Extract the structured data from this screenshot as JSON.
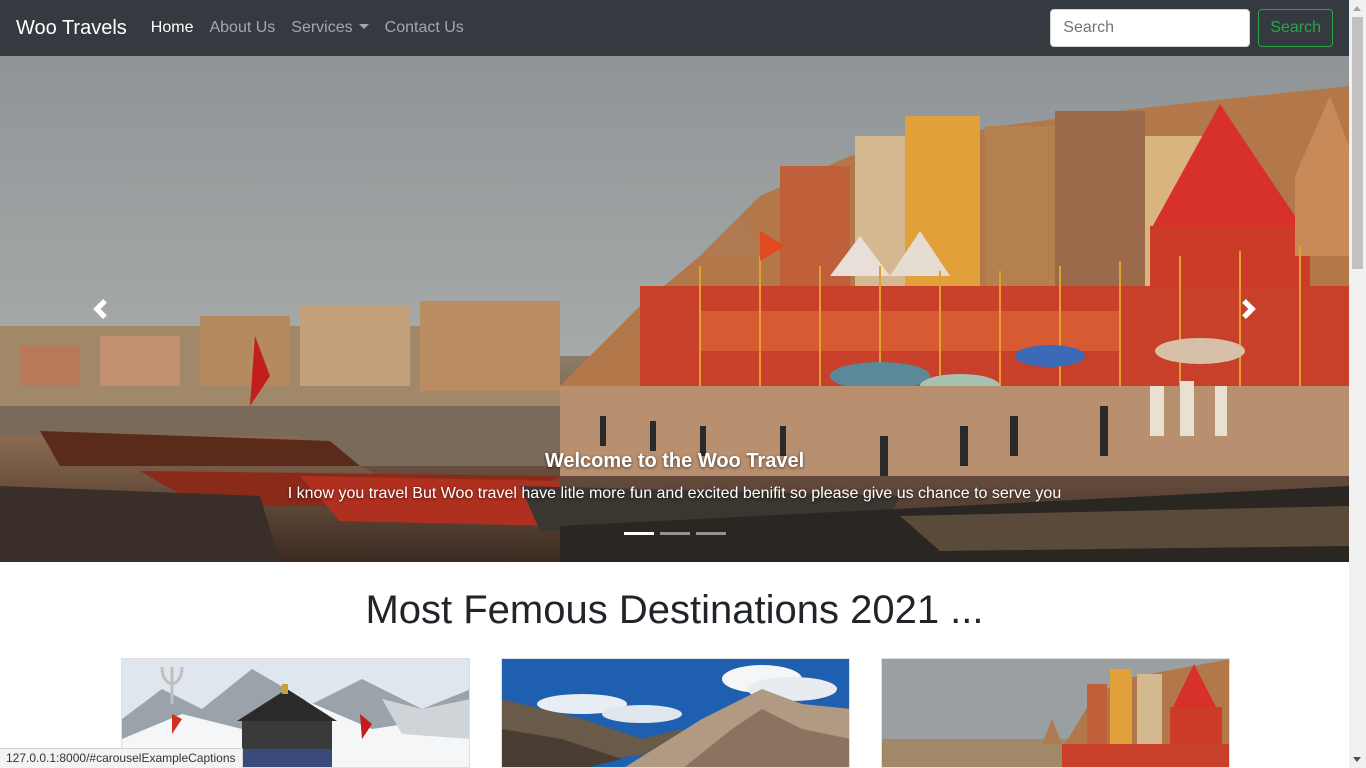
{
  "navbar": {
    "brand": "Woo Travels",
    "links": [
      {
        "label": "Home"
      },
      {
        "label": "About Us"
      },
      {
        "label": "Services"
      },
      {
        "label": "Contact Us"
      }
    ],
    "search": {
      "placeholder": "Search",
      "button_label": "Search"
    }
  },
  "carousel": {
    "caption_title": "Welcome to the Woo Travel",
    "caption_text": "I know you travel But Woo travel have litle more fun and excited benifit so please give us chance to serve you",
    "slide_count": 3,
    "active_slide": 1,
    "prev_icon": "chevron-left-icon",
    "next_icon": "chevron-right-icon"
  },
  "destinations": {
    "title": "Most Femous Destinations 2021 ..."
  },
  "status_bar": {
    "url": "127.0.0.1:8000/#carouselExampleCaptions"
  },
  "colors": {
    "navbar_bg": "#343a40",
    "success": "#28a745",
    "heading": "#212529"
  }
}
